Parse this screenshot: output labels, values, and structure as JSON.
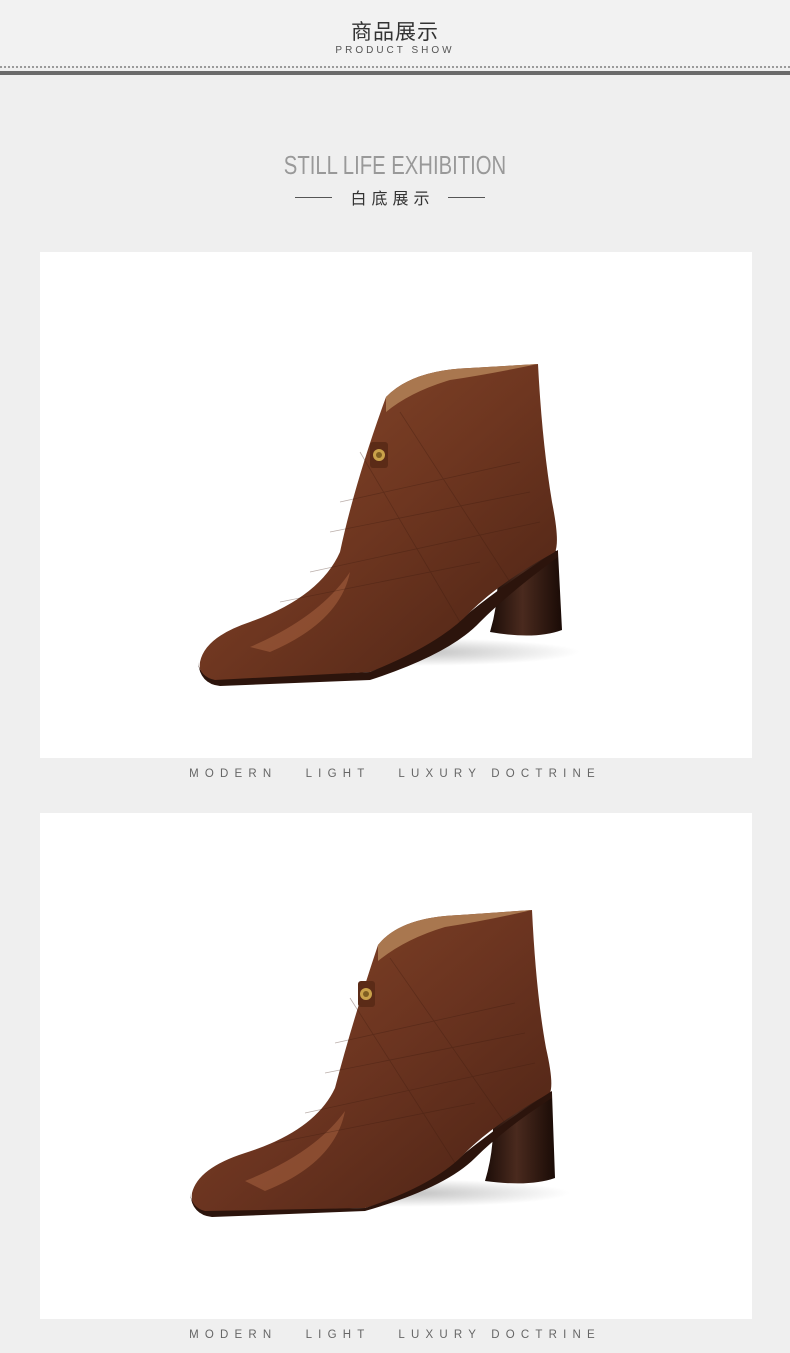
{
  "header": {
    "title": "商品展示",
    "subtitle": "PRODUCT SHOW"
  },
  "section": {
    "title": "STILL LIFE  EXHIBITION",
    "subtitle": "白底展示"
  },
  "photos": [
    {
      "subject": "brown leather ankle boot with block heel",
      "caption": "MODERN   LIGHT   LUXURY DOCTRINE"
    },
    {
      "subject": "brown leather ankle boot with block heel",
      "caption": "MODERN   LIGHT   LUXURY DOCTRINE"
    }
  ],
  "colors": {
    "background": "#efefef",
    "photo_background": "#ffffff",
    "leather": "#6b3520",
    "heel": "#2a1510"
  }
}
